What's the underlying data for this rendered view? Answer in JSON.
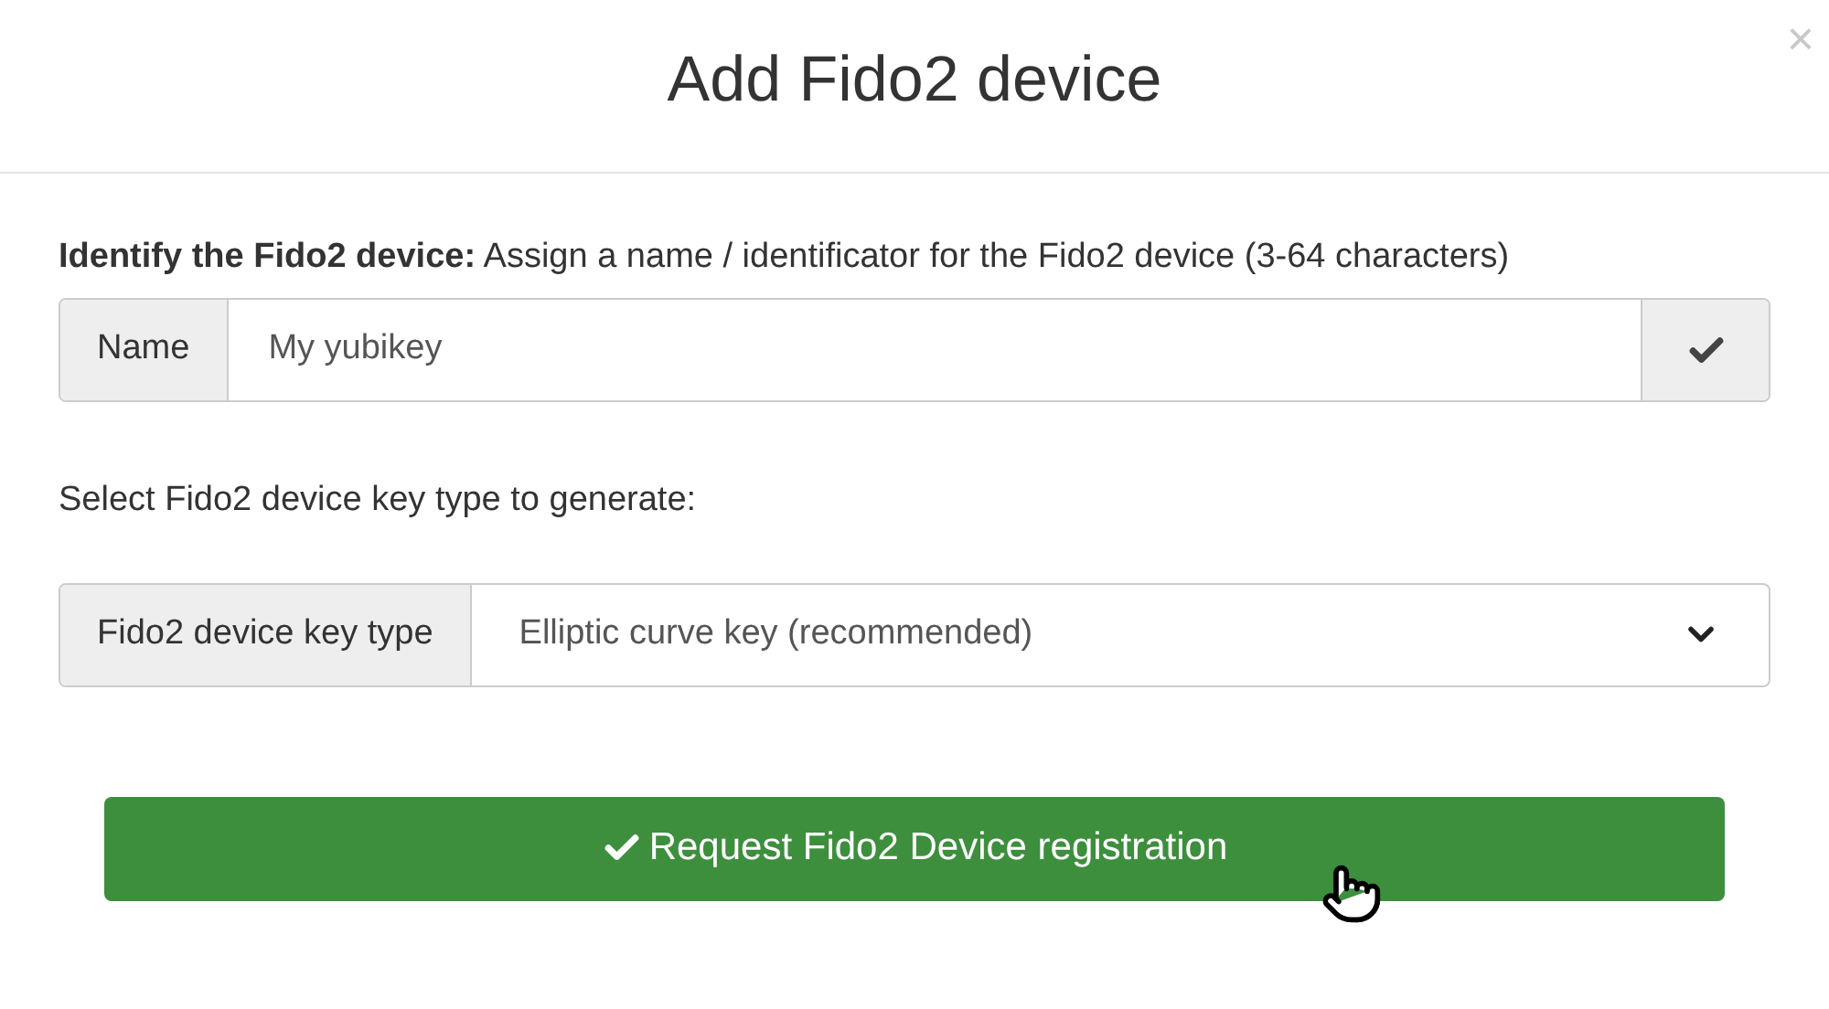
{
  "dialog": {
    "title": "Add Fido2 device",
    "close": "×"
  },
  "name_section": {
    "intro": "**Identify the Fido2 device:** Assign a name / identificator for the Fido2 device (3-64 characters)",
    "addon": "Name",
    "value": "My yubikey",
    "valid": true
  },
  "key_section": {
    "intro": "Select Fido2 device key type to generate:",
    "addon": "Fido2 device key type",
    "value": "Elliptic curve key (recommended)"
  },
  "submit": {
    "label": "Request Fido2 Device registration"
  }
}
